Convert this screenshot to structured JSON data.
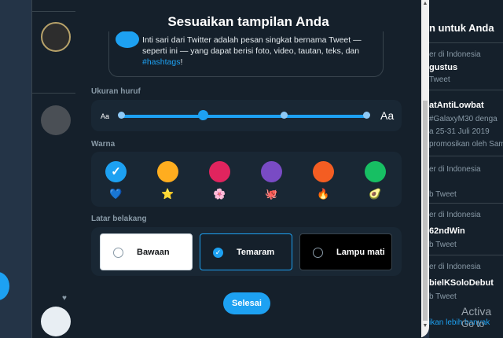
{
  "modal": {
    "title": "Sesuaikan tampilan Anda",
    "preview_text": "Inti sari dari Twitter adalah pesan singkat bernama Tweet — seperti ini — yang dapat berisi foto, video, tautan, teks, dan ",
    "preview_hashtag": "#hashtags",
    "preview_end": "!",
    "font_size_label": "Ukuran huruf",
    "font_small": "Aa",
    "font_large": "Aa",
    "font_size_level": 2,
    "font_size_steps": 5,
    "color_label": "Warna",
    "colors": [
      {
        "hex": "#1da1f2",
        "emoji": "💙",
        "selected": true
      },
      {
        "hex": "#ffad1f",
        "emoji": "⭐",
        "selected": false
      },
      {
        "hex": "#e0245e",
        "emoji": "🌸",
        "selected": false
      },
      {
        "hex": "#794bc4",
        "emoji": "🐙",
        "selected": false
      },
      {
        "hex": "#f45d22",
        "emoji": "🔥",
        "selected": false
      },
      {
        "hex": "#17bf63",
        "emoji": "🥑",
        "selected": false
      }
    ],
    "background_label": "Latar belakang",
    "backgrounds": [
      {
        "label": "Bawaan",
        "bg": "#ffffff",
        "text": "#14171a",
        "selected": false
      },
      {
        "label": "Temaram",
        "bg": "#15202b",
        "text": "#ffffff",
        "selected": true
      },
      {
        "label": "Lampu mati",
        "bg": "#000000",
        "text": "#ffffff",
        "selected": false
      }
    ],
    "done_label": "Selesai"
  },
  "sidebar": {
    "title": "n untuk Anda",
    "trends": [
      {
        "meta": "er di Indonesia",
        "tag": "gustus",
        "count": "Tweet"
      },
      {
        "meta": "",
        "tag": "atAntiLowbat",
        "count": ""
      },
      {
        "meta": "",
        "tag": "",
        "count": ""
      },
      {
        "meta": "er di Indonesia",
        "tag": "62ndWin",
        "count": "b Tweet"
      },
      {
        "meta": "er di Indonesia",
        "tag": "bielKSoloDebut",
        "count": "b Tweet"
      }
    ],
    "promo_lines": [
      "#GalaxyM30 denga",
      "a 25-31 Juli 2019",
      "promosikan oleh Sam"
    ],
    "trend3_meta": "er di Indonesia",
    "trend3_count": "b Tweet",
    "more_link": "ikan lebih banyak",
    "activate_line1": "Activa",
    "activate_line2": "Go to"
  }
}
